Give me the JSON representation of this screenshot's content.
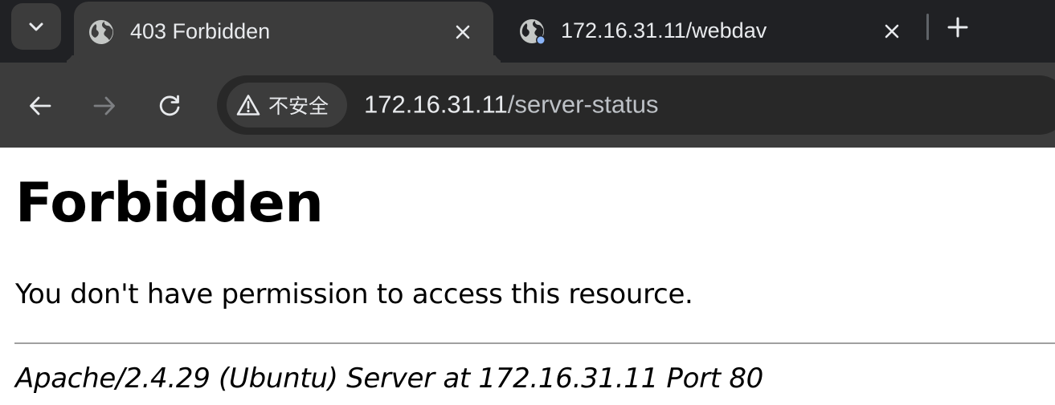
{
  "browser": {
    "tabs": [
      {
        "title": "403 Forbidden",
        "active": true,
        "favicon": "globe-icon"
      },
      {
        "title": "172.16.31.11/webdav",
        "active": false,
        "favicon": "globe-icon"
      }
    ],
    "omnibox": {
      "security_label": "不安全",
      "security_icon": "warning-triangle-icon",
      "url_host": "172.16.31.11",
      "url_path": "/server-status"
    },
    "colors": {
      "tabstrip": "#202124",
      "toolbar": "#3c3c3c",
      "text": "#e8eaed",
      "loading_dot": "#8ab4f8"
    }
  },
  "page": {
    "title": "Forbidden",
    "message": "You don't have permission to access this resource.",
    "address": "Apache/2.4.29 (Ubuntu) Server at 172.16.31.11 Port 80"
  }
}
